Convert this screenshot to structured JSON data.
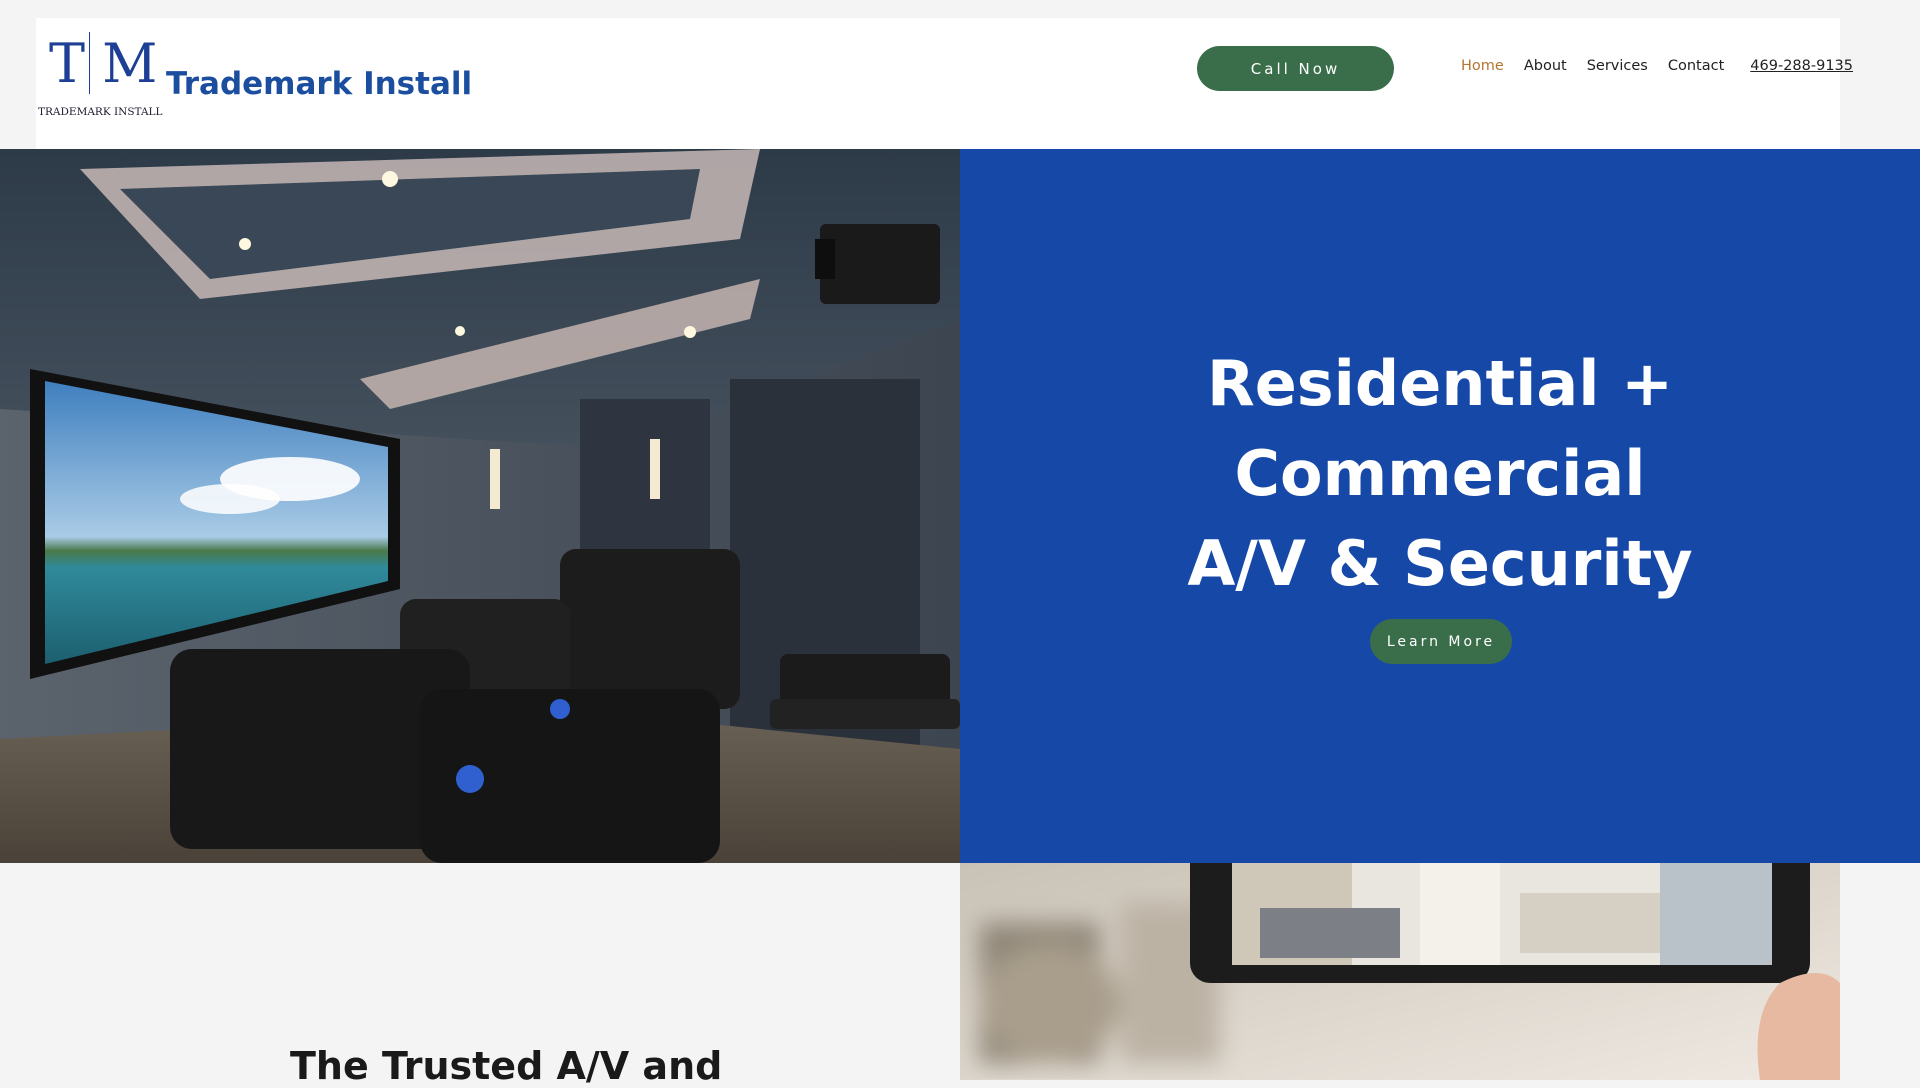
{
  "header": {
    "logo_monogram": "T|M",
    "logo_subtitle": "TRADEMARK INSTALL",
    "brand_name": "Trademark Install",
    "call_button": "Call Now",
    "nav": [
      "Home",
      "About",
      "Services",
      "Contact"
    ],
    "phone": "469-288-9135"
  },
  "hero": {
    "heading_lines": [
      "Residential +",
      "Commercial",
      "A/V & Security"
    ],
    "cta_label": "Learn More"
  },
  "section2": {
    "title": "The Trusted A/V and"
  },
  "colors": {
    "brand_blue": "#1648a8",
    "button_green": "#3a6e4b",
    "nav_active": "#b5742f"
  }
}
